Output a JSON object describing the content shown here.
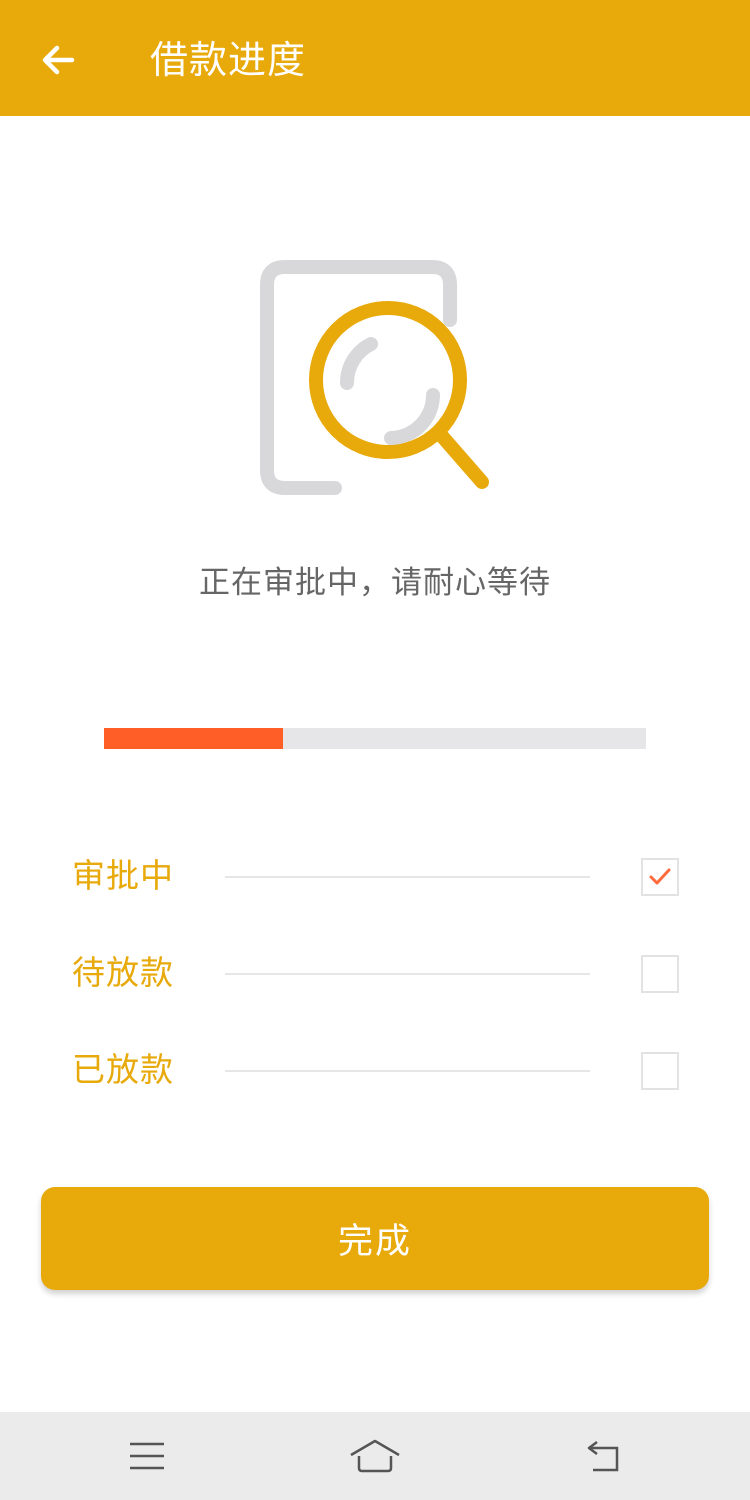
{
  "header": {
    "title": "借款进度",
    "back_icon": "arrow-left-icon"
  },
  "illustration": {
    "icon": "document-search-icon",
    "colors": {
      "document": "#D8D8DA",
      "magnifier": "#E8A90B"
    }
  },
  "status": {
    "message": "正在审批中，请耐心等待"
  },
  "progress": {
    "percent": 33,
    "fill_color": "#FF5F26",
    "track_color": "#E6E6E8"
  },
  "steps": [
    {
      "label": "审批中",
      "checked": true
    },
    {
      "label": "待放款",
      "checked": false
    },
    {
      "label": "已放款",
      "checked": false
    }
  ],
  "actions": {
    "done_label": "完成"
  },
  "system_nav": {
    "menu_icon": "menu-icon",
    "home_icon": "home-icon",
    "back_icon": "back-icon"
  },
  "colors": {
    "accent": "#E8A90B",
    "check": "#FF6A3D",
    "text_muted": "#666666"
  }
}
